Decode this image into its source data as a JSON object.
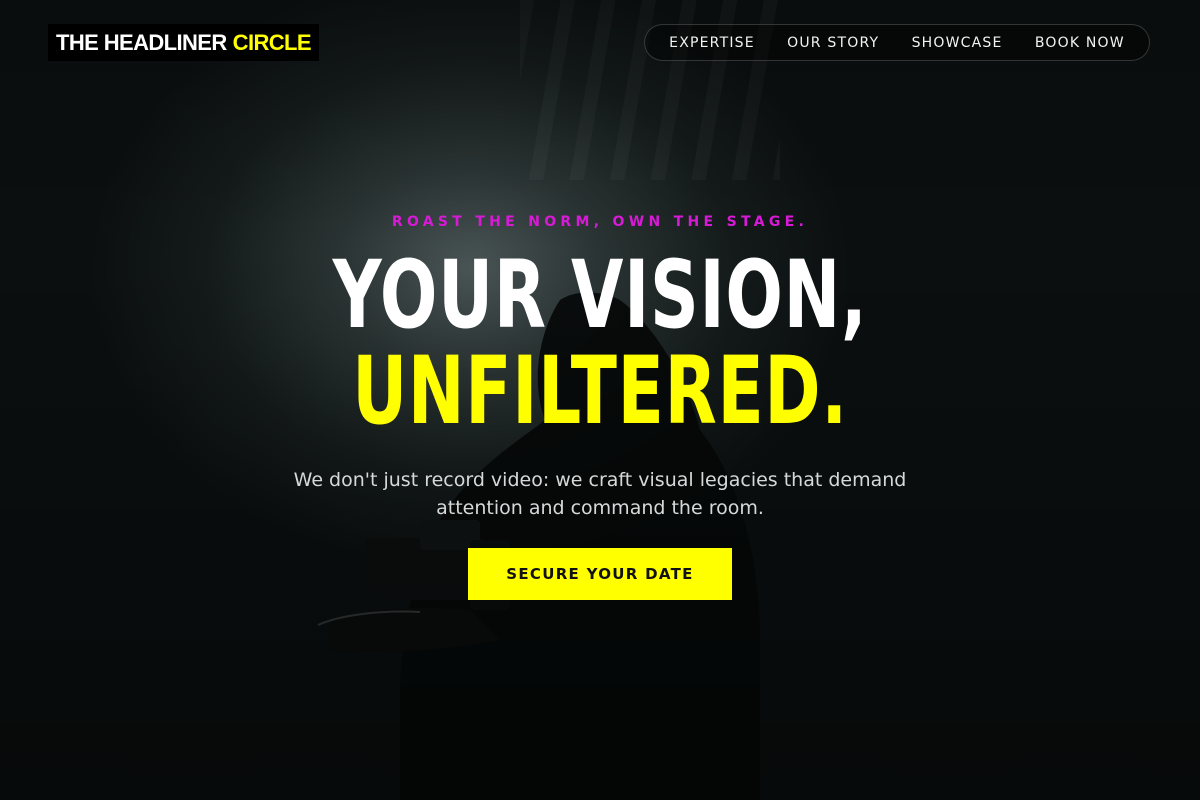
{
  "brand": {
    "name_main": "THE HEADLINER",
    "name_accent": "CIRCLE"
  },
  "nav": {
    "items": [
      {
        "label": "EXPERTISE"
      },
      {
        "label": "OUR STORY"
      },
      {
        "label": "SHOWCASE"
      },
      {
        "label": "BOOK NOW"
      }
    ]
  },
  "hero": {
    "eyebrow": "ROAST THE NORM, OWN THE STAGE.",
    "headline_line1": "YOUR VISION,",
    "headline_line2": "UNFILTERED.",
    "subtext": "We don't just record video: we craft visual legacies that demand attention and command the room.",
    "cta_label": "SECURE YOUR DATE",
    "background": "camera-operator-silhouette"
  },
  "colors": {
    "accent": "#ffff00",
    "eyebrow": "#d81ad8",
    "background": "#0b0f0f"
  }
}
